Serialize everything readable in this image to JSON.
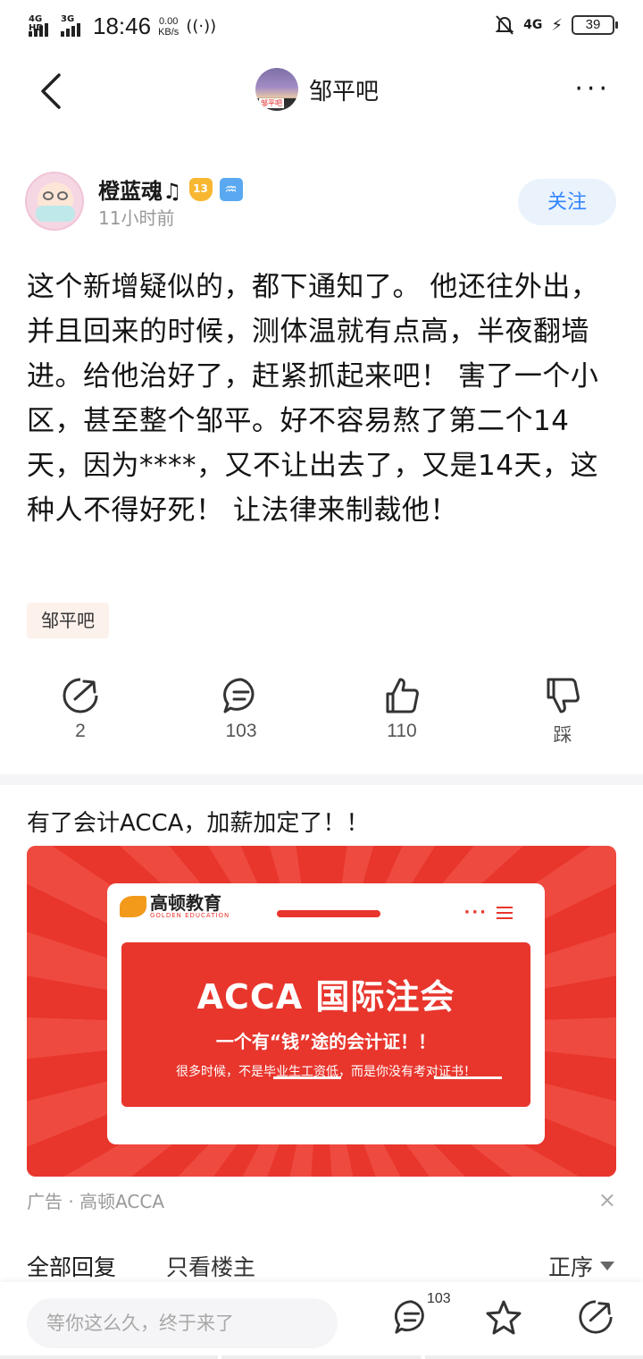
{
  "status_bar": {
    "sig1_tag": "4G HD",
    "sig2_tag": "3G",
    "time": "18:46",
    "speed_value": "0.00",
    "speed_unit": "KB/s",
    "net_right": "4G",
    "battery": "39"
  },
  "nav": {
    "title": "邹平吧",
    "avatar_stamp": "邹平吧"
  },
  "author": {
    "name": "橙蓝魂♫",
    "level": "13",
    "zodiac_symbol": "♒",
    "time_ago": "11小时前",
    "follow_label": "关注"
  },
  "post": {
    "text": "这个新增疑似的，都下通知了。 他还往外出，并且回来的时候，测体温就有点高，半夜翻墙进。给他治好了，赶紧抓起来吧！ 害了一个小区，甚至整个邹平。好不容易熬了第二个14天，因为****，又不让出去了，又是14天，这种人不得好死！ 让法律来制裁他！",
    "forum_tag": "邹平吧"
  },
  "actions": {
    "share_count": "2",
    "comment_count": "103",
    "like_count": "110",
    "dislike_label": "踩"
  },
  "ad": {
    "title": "有了会计ACCA，加薪加定了！！",
    "logo_name": "高顿教育",
    "logo_sub": "GOLDEN EDUCATION",
    "headline": "ACCA 国际注会",
    "subheadline": "一个有“钱”途的会计证！！",
    "tagline": "很多时候，不是毕业生工资低，而是你没有考对证书！",
    "meta": "广告 · 高顿ACCA",
    "close_symbol": "×"
  },
  "replies": {
    "all_label": "全部回复",
    "op_only_label": "只看楼主",
    "sort_label": "正序"
  },
  "bottom_bar": {
    "input_placeholder": "等你这么久，终于来了",
    "comment_badge": "103"
  },
  "colors": {
    "accent_blue": "#3385ff",
    "ad_red": "#e8362d",
    "follow_bg": "#eaf3fc"
  }
}
